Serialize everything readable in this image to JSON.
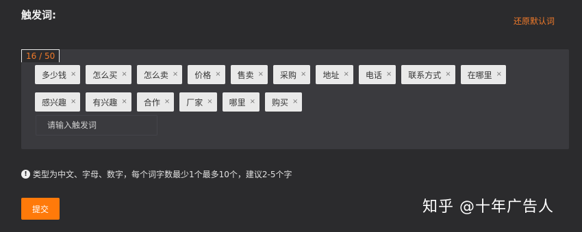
{
  "form": {
    "title": "触发词:",
    "restore_label": "还原默认词",
    "counter": "16 / 50",
    "tags": [
      {
        "label": "多少钱",
        "close": "×"
      },
      {
        "label": "怎么买",
        "close": "×"
      },
      {
        "label": "怎么卖",
        "close": "×"
      },
      {
        "label": "价格",
        "close": "×"
      },
      {
        "label": "售卖",
        "close": "×"
      },
      {
        "label": "采购",
        "close": "×"
      },
      {
        "label": "地址",
        "close": "×"
      },
      {
        "label": "电话",
        "close": "×"
      },
      {
        "label": "联系方式",
        "close": "×"
      },
      {
        "label": "在哪里",
        "close": "×"
      },
      {
        "label": "感兴趣",
        "close": "×"
      },
      {
        "label": "有兴趣",
        "close": "×"
      },
      {
        "label": "合作",
        "close": "×"
      },
      {
        "label": "厂家",
        "close": "×"
      },
      {
        "label": "哪里",
        "close": "×"
      },
      {
        "label": "购买",
        "close": "×"
      }
    ],
    "input_placeholder": "请输入触发词",
    "hint_icon": "info-icon",
    "hint_icon_glyph": "!",
    "hint_text": "类型为中文、字母、数字，每个词字数最少1个最多10个，建议2-5个字",
    "submit_label": "提交"
  },
  "watermark": "知乎 @十年广告人",
  "colors": {
    "background": "#2b2b2d",
    "panel": "#3a3a3e",
    "accent": "#ff7a0a",
    "link": "#f07a2a",
    "tag_bg": "#e9e9e9"
  }
}
